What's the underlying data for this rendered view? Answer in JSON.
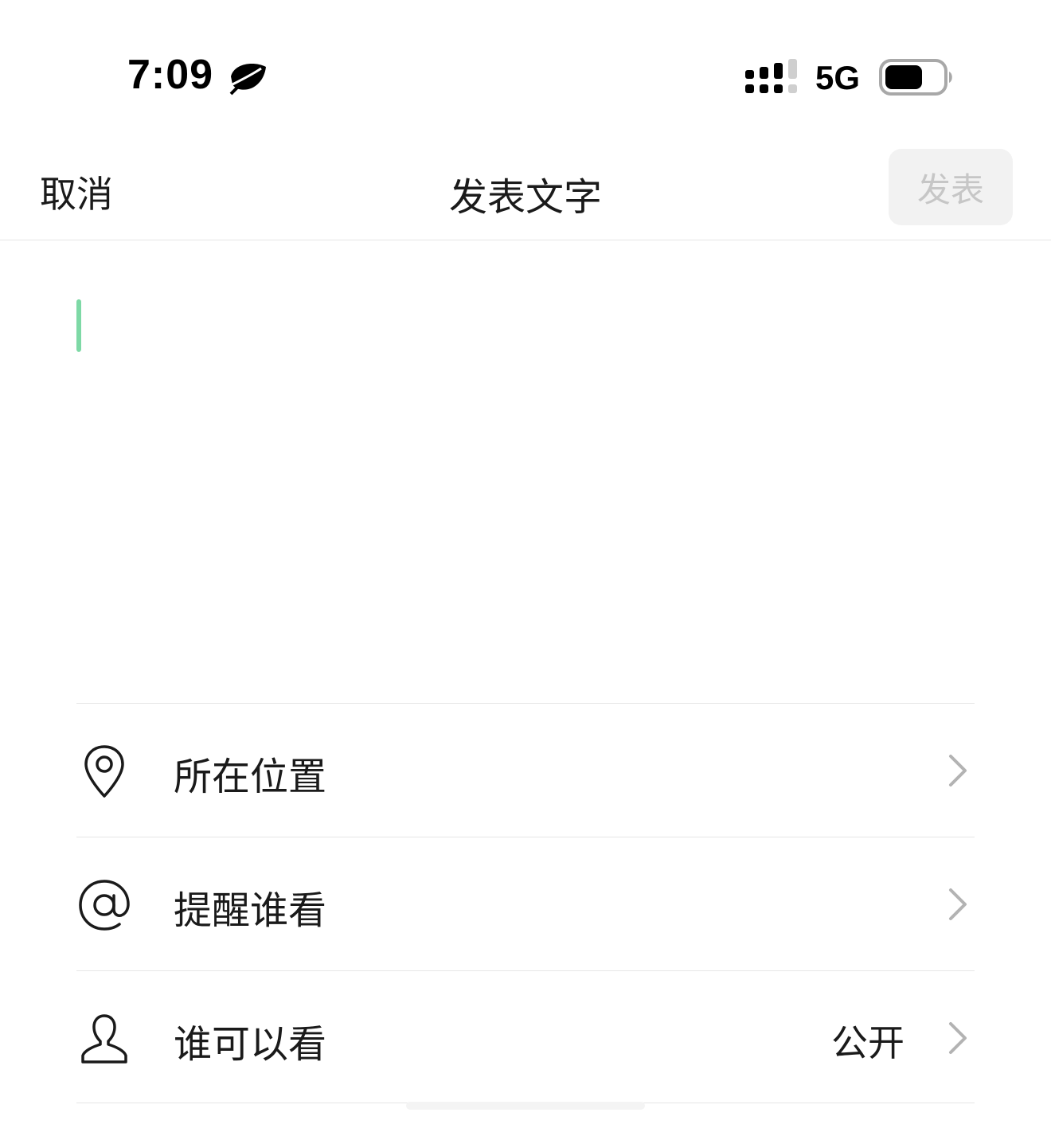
{
  "status_bar": {
    "time": "7:09",
    "network": "5G",
    "icons": [
      "leaf-icon",
      "signal-icon",
      "battery-icon"
    ]
  },
  "nav": {
    "cancel_label": "取消",
    "title": "发表文字",
    "publish_label": "发表"
  },
  "compose": {
    "value": "",
    "caret_color": "#7ed9a6"
  },
  "options": [
    {
      "icon": "location-pin-icon",
      "label": "所在位置",
      "value": ""
    },
    {
      "icon": "at-sign-icon",
      "label": "提醒谁看",
      "value": ""
    },
    {
      "icon": "person-icon",
      "label": "谁可以看",
      "value": "公开"
    }
  ],
  "colors": {
    "text": "#1a1a1a",
    "divider": "#e6e6e6",
    "publish_disabled_bg": "#f2f2f2",
    "publish_disabled_text": "#c6c6c6",
    "chevron": "#b3b3b3"
  }
}
